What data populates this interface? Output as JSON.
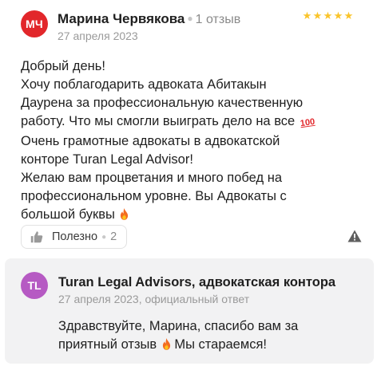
{
  "review": {
    "avatar_initials": "МЧ",
    "avatar_color": "#e2272b",
    "author": "Марина Червякова",
    "reviews_count": "1 отзыв",
    "date": "27 апреля 2023",
    "rating": 5,
    "rating_color": "#fac42a",
    "lines": [
      "Добрый день!",
      "Хочу поблагодарить адвоката Абитакын",
      "Даурена за профессиональную качественную",
      "работу. Что мы смогли выиграть дело на все",
      "Очень грамотные адвокаты в адвокатской",
      "конторе Turan Legal Advisor!",
      "Желаю вам процветания и много побед на",
      "профессиональном уровне. Вы Адвокаты с",
      "большой буквы"
    ],
    "hundred_emoji": "100"
  },
  "actions": {
    "helpful_label": "Полезно",
    "helpful_count": "2",
    "icons": [
      "thumbs-up-icon",
      "warning-icon"
    ]
  },
  "reply": {
    "avatar_initials": "TL",
    "avatar_color": "#b65ac3",
    "company": "Turan Legal Advisors, адвокатская контора",
    "date_line": "27 апреля 2023, официальный ответ",
    "lines": [
      "Здравствуйте, Марина, спасибо вам за",
      "приятный отзыв",
      "Мы стараемся!"
    ]
  }
}
